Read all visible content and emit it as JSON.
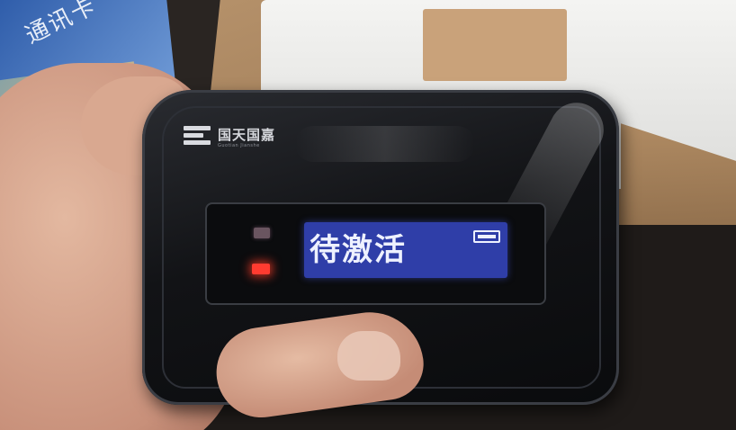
{
  "scene": {
    "description_items": [
      "card",
      "hand",
      "device",
      "box"
    ]
  },
  "card": {
    "text": "通讯卡"
  },
  "device": {
    "brand_name": "国天国嘉",
    "brand_sub": "Guotian Jianshe",
    "lcd_text": "待激活",
    "status_led_color": "#ff3b30",
    "lcd_color": "#2f3ea8"
  }
}
